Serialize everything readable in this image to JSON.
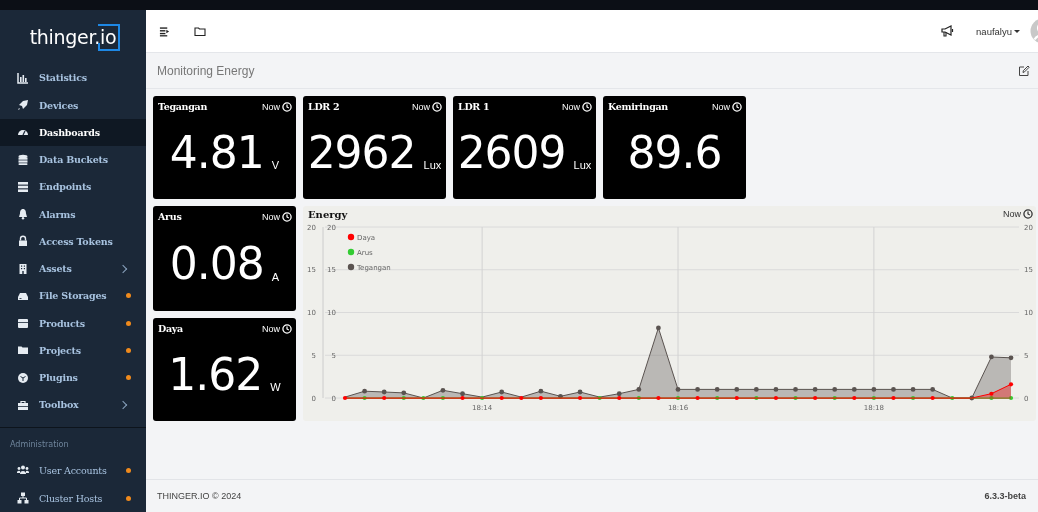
{
  "sidebar": {
    "logo": "thinger.io",
    "items": [
      {
        "label": "Statistics",
        "selected": false,
        "submenu": false,
        "notification": false
      },
      {
        "label": "Devices",
        "selected": false,
        "submenu": false,
        "notification": false
      },
      {
        "label": "Dashboards",
        "selected": true,
        "submenu": false,
        "notification": false
      },
      {
        "label": "Data Buckets",
        "selected": false,
        "submenu": false,
        "notification": false
      },
      {
        "label": "Endpoints",
        "selected": false,
        "submenu": false,
        "notification": false
      },
      {
        "label": "Alarms",
        "selected": false,
        "submenu": false,
        "notification": false
      },
      {
        "label": "Access Tokens",
        "selected": false,
        "submenu": false,
        "notification": false
      },
      {
        "label": "Assets",
        "selected": false,
        "submenu": true,
        "notification": false
      },
      {
        "label": "File Storages",
        "selected": false,
        "submenu": false,
        "notification": true
      },
      {
        "label": "Products",
        "selected": false,
        "submenu": false,
        "notification": true
      },
      {
        "label": "Projects",
        "selected": false,
        "submenu": false,
        "notification": true
      },
      {
        "label": "Plugins",
        "selected": false,
        "submenu": false,
        "notification": true
      },
      {
        "label": "Toolbox",
        "selected": false,
        "submenu": true,
        "notification": false
      }
    ],
    "admin_section": {
      "heading": "Administration",
      "items": [
        {
          "label": "User Accounts",
          "selected": false,
          "submenu": false,
          "notification": true
        },
        {
          "label": "Cluster Hosts",
          "selected": false,
          "submenu": false,
          "notification": true
        }
      ]
    }
  },
  "topbar": {
    "user": "naufalyu"
  },
  "page": {
    "title": "Monitoring Energy"
  },
  "cards": [
    {
      "title": "Tegangan",
      "time_label": "Now",
      "value": "4.81",
      "unit": "V"
    },
    {
      "title": "LDR 2",
      "time_label": "Now",
      "value": "2962",
      "unit": "Lux"
    },
    {
      "title": "LDR 1",
      "time_label": "Now",
      "value": "2609",
      "unit": "Lux"
    },
    {
      "title": "Kemiringan",
      "time_label": "Now",
      "value": "89.6"
    },
    {
      "title": "Arus",
      "time_label": "Now",
      "value": "0.08",
      "unit": "A"
    },
    {
      "title": "Daya",
      "time_label": "Now",
      "value": "1.62",
      "unit": "W"
    }
  ],
  "chart_widget": {
    "title": "Energy",
    "time_label": "Now",
    "chart_data": {
      "type": "area",
      "ylim": [
        0,
        20
      ],
      "yticks": [
        0,
        5,
        10,
        15,
        20
      ],
      "categories": [
        null,
        null,
        null,
        null,
        null,
        null,
        null,
        "18:14",
        null,
        null,
        null,
        null,
        null,
        null,
        null,
        null,
        null,
        "18:16",
        null,
        null,
        null,
        null,
        null,
        null,
        null,
        null,
        null,
        "18:18",
        null,
        null,
        null,
        null,
        null,
        null,
        null
      ],
      "series": [
        {
          "name": "Daya",
          "color": "#ff0000",
          "values": [
            0,
            0,
            0,
            0,
            0,
            0,
            0,
            0,
            0,
            0,
            0,
            0,
            0,
            0,
            0,
            0,
            0,
            0,
            0,
            0,
            0,
            0,
            0,
            0,
            0,
            0,
            0,
            0,
            0,
            0,
            0,
            0,
            0,
            0.5,
            1.6
          ]
        },
        {
          "name": "Arus",
          "color": "#33cc33",
          "values": [
            0,
            0,
            0,
            0,
            0,
            0,
            0,
            0,
            0,
            0,
            0,
            0,
            0,
            0,
            0,
            0,
            0,
            0,
            0,
            0,
            0,
            0,
            0,
            0,
            0,
            0,
            0,
            0,
            0,
            0,
            0,
            0,
            0,
            0,
            0
          ]
        },
        {
          "name": "Tegangan",
          "color": "#5a5350",
          "values": [
            0.1,
            0.8,
            0.7,
            0.6,
            0,
            0.9,
            0.5,
            0.1,
            0.7,
            0.1,
            0.8,
            0.2,
            0.7,
            0.1,
            0.5,
            1.0,
            8.2,
            1,
            1,
            1,
            1,
            1,
            1,
            1,
            1,
            1,
            1,
            1,
            1,
            1,
            1.0,
            0,
            0,
            4.8,
            4.7
          ]
        }
      ],
      "grid": true,
      "legend": "upper left",
      "annotations": [
        "0",
        "5",
        "10",
        "15",
        "20",
        "0",
        "5",
        "10",
        "15",
        "20"
      ]
    }
  },
  "footer": {
    "copyright": "THINGER.IO © 2024",
    "version": "6.3.3-beta"
  }
}
